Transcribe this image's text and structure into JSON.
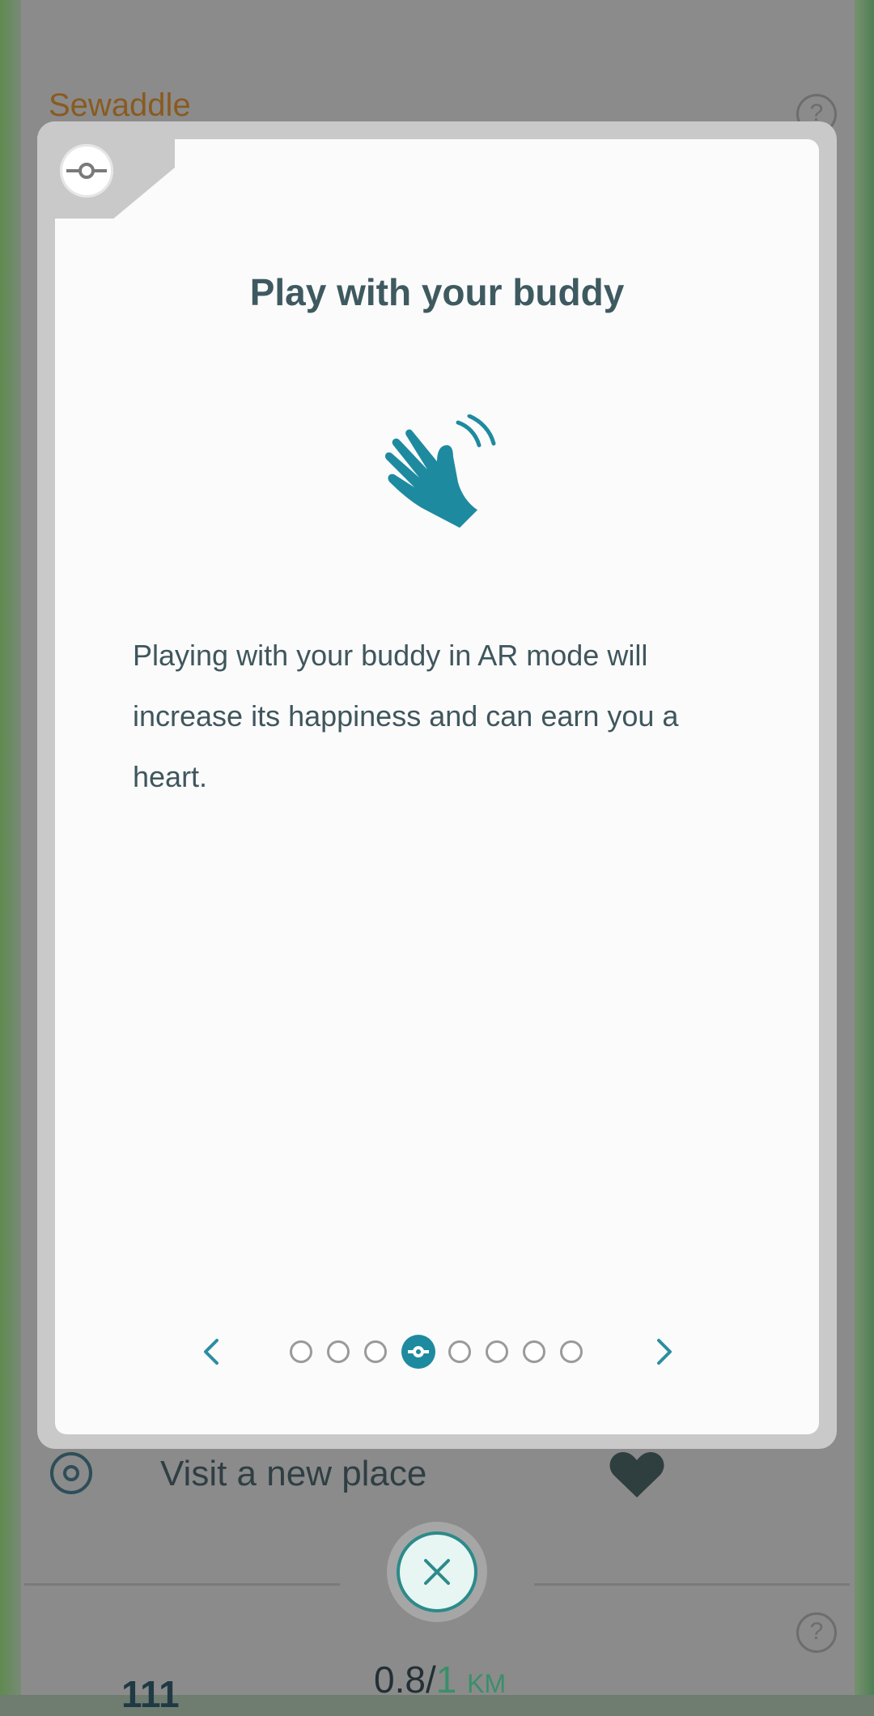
{
  "background": {
    "pokemon_name": "Sewaddle",
    "help_glyph": "?",
    "visible_activity": "Visit a new place",
    "distance": {
      "current": "0.8",
      "separator": "/",
      "goal": "1",
      "unit": "KM"
    },
    "count_partial": "111"
  },
  "modal": {
    "title": "Play with your buddy",
    "body": "Playing with your buddy in AR mode will increase its happiness and can earn you a heart.",
    "pagination": {
      "total": 8,
      "active_index": 3
    }
  },
  "icons": {
    "header": "pokeball-icon",
    "main": "waving-hand-icon",
    "prev": "chevron-left-icon",
    "next": "chevron-right-icon",
    "close": "close-icon"
  },
  "colors": {
    "accent": "#1e8aa0",
    "title": "#3e5a60",
    "body": "#3f565d",
    "overlay": "#8b8b8b"
  }
}
